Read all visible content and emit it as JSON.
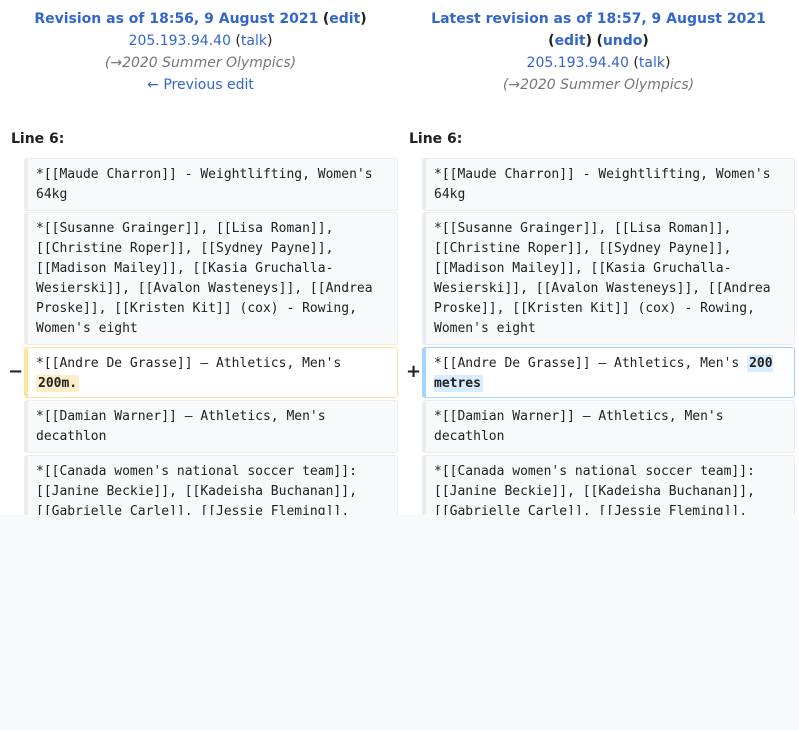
{
  "left_header": {
    "title": "Revision as of 18:56, 9 August 2021",
    "edit": "edit",
    "user": "205.193.94.40",
    "talk": "talk",
    "comment": "→2020 Summer Olympics",
    "prev": "← Previous edit"
  },
  "right_header": {
    "title": "Latest revision as of 18:57, 9 August 2021",
    "edit": "edit",
    "undo": "undo",
    "user": "205.193.94.40",
    "talk": "talk",
    "comment": "→2020 Summer Olympics"
  },
  "line_label_left": "Line 6:",
  "line_label_right": "Line 6:",
  "markers": {
    "removed": "−",
    "added": "+"
  },
  "rows": [
    {
      "left": "*[[Maude Charron]] - Weightlifting, Women's 64kg",
      "right": "*[[Maude Charron]] - Weightlifting, Women's 64kg"
    },
    {
      "left": "*[[Susanne Grainger]], [[Lisa Roman]], [[Christine Roper]], [[Sydney Payne]], [[Madison Mailey]], [[Kasia Gruchalla-Wesierski]], [[Avalon Wasteneys]], [[Andrea Proske]], [[Kristen Kit]] (cox) - Rowing, Women's eight",
      "right": "*[[Susanne Grainger]], [[Lisa Roman]], [[Christine Roper]], [[Sydney Payne]], [[Madison Mailey]], [[Kasia Gruchalla-Wesierski]], [[Avalon Wasteneys]], [[Andrea Proske]], [[Kristen Kit]] (cox) - Rowing, Women's eight"
    },
    {
      "left_prefix": "*[[Andre De Grasse]] – Athletics, Men's ",
      "left_change": "200m.",
      "right_prefix": "*[[Andre De Grasse]] – Athletics, Men's ",
      "right_change": "200 metres"
    },
    {
      "left": "*[[Damian Warner]] – Athletics, Men's decathlon",
      "right": "*[[Damian Warner]] – Athletics, Men's decathlon"
    },
    {
      "left": "*[[Canada women's national soccer team]]: [[Janine Beckie]], [[Kadeisha Buchanan]], [[Gabrielle Carle]], [[Jessie Fleming]],",
      "right": "*[[Canada women's national soccer team]]: [[Janine Beckie]], [[Kadeisha Buchanan]], [[Gabrielle Carle]], [[Jessie Fleming]],"
    }
  ]
}
